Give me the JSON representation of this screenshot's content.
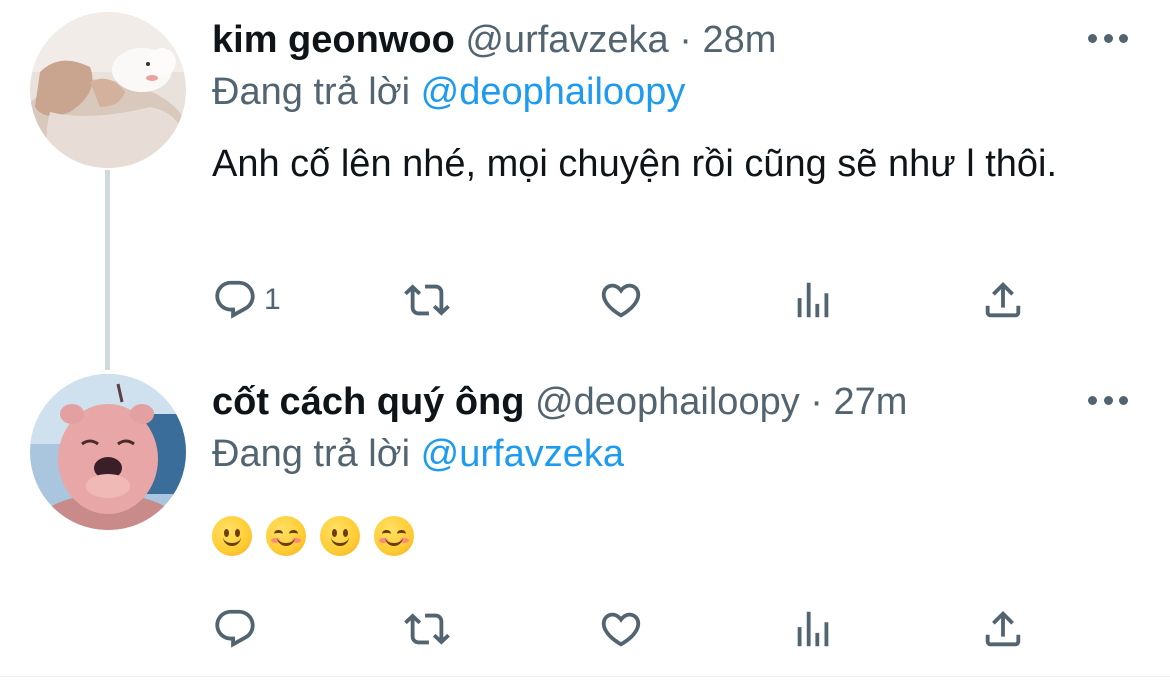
{
  "tweets": [
    {
      "display_name": "kim geonwoo",
      "handle": "@urfavzeka",
      "separator": "·",
      "time": "28m",
      "replying_prefix": "Đang trả lời",
      "replying_to": "@deophailoopy",
      "text": "Anh cố lên nhé, mọi chuyện rồi cũng sẽ như l thôi.",
      "reply_count": "1",
      "avatar_icon": "puppy-photo-avatar"
    },
    {
      "display_name": "cốt cách quý ông",
      "handle": "@deophailoopy",
      "separator": "·",
      "time": "27m",
      "replying_prefix": "Đang trả lời",
      "replying_to": "@urfavzeka",
      "emojis": [
        "slightly-smiling-face",
        "smiling-face",
        "slightly-smiling-face",
        "smiling-face"
      ],
      "reply_count": "",
      "avatar_icon": "pink-beaver-avatar"
    }
  ],
  "icons": {
    "reply": "reply-icon",
    "retweet": "retweet-icon",
    "like": "like-icon",
    "stats": "analytics-icon",
    "share": "share-icon",
    "more": "more-icon"
  },
  "colors": {
    "accent": "#1d9bf0",
    "secondary_text": "#536471",
    "primary_text": "#0f1419",
    "thread_line": "#cfd9de"
  }
}
